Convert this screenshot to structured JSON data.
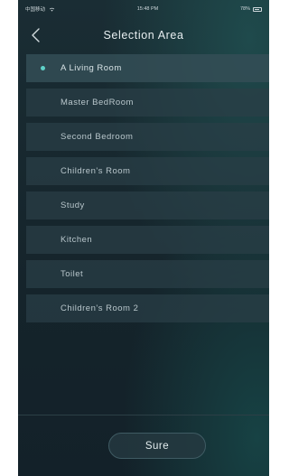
{
  "status_bar": {
    "carrier": "中国移动",
    "time": "15:48 PM",
    "battery": "78%"
  },
  "header": {
    "title": "Selection Area"
  },
  "areas": {
    "items": [
      {
        "label": "A Living Room",
        "selected": true
      },
      {
        "label": "Master BedRoom",
        "selected": false
      },
      {
        "label": "Second Bedroom",
        "selected": false
      },
      {
        "label": "Children's Room",
        "selected": false
      },
      {
        "label": "Study",
        "selected": false
      },
      {
        "label": "Kitchen",
        "selected": false
      },
      {
        "label": "Toilet",
        "selected": false
      },
      {
        "label": "Children's Room 2",
        "selected": false
      }
    ]
  },
  "footer": {
    "sure_label": "Sure"
  },
  "colors": {
    "accent": "#5fd1c8",
    "background": "#15242b",
    "item_background": "#2a3e46"
  }
}
